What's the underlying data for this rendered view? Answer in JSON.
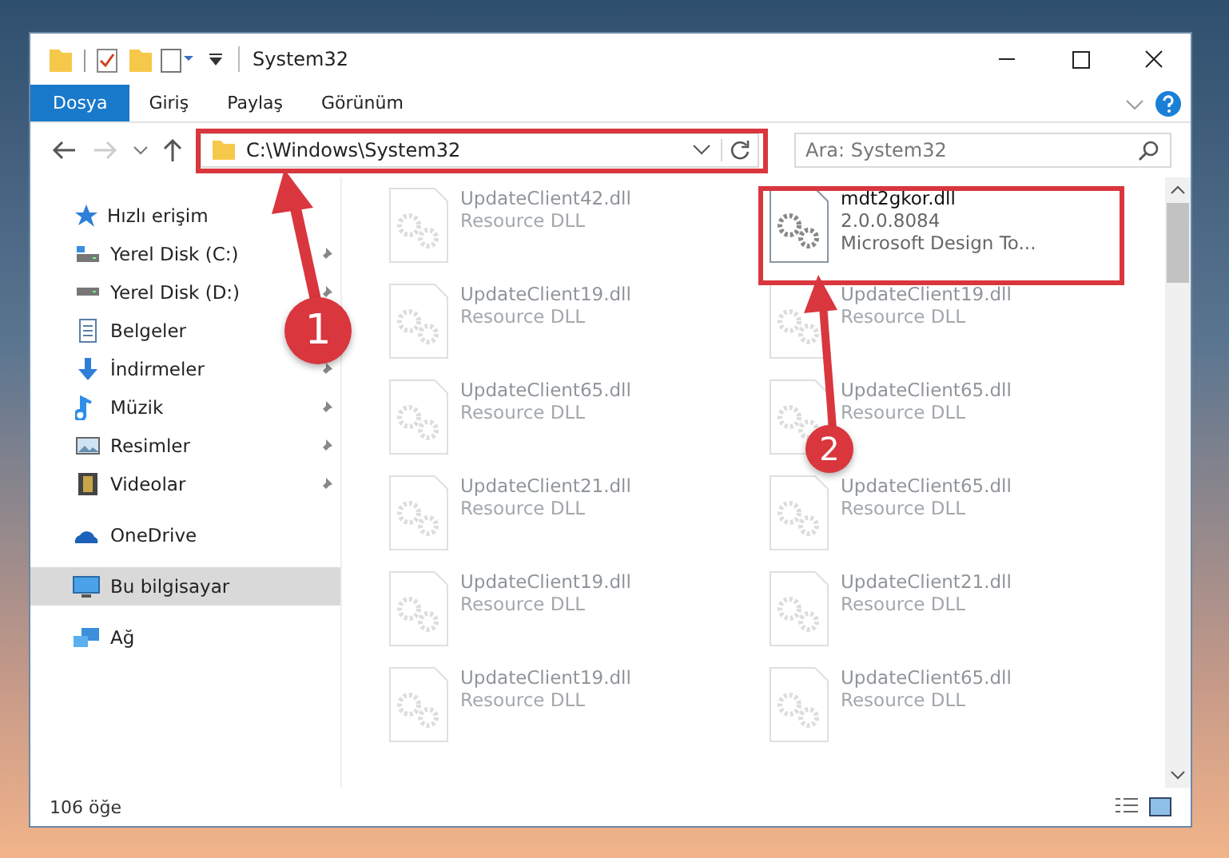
{
  "window": {
    "title": "System32"
  },
  "ribbon_tabs": [
    {
      "label": "Dosya",
      "selected": true
    },
    {
      "label": "Giriş",
      "selected": false
    },
    {
      "label": "Paylaş",
      "selected": false
    },
    {
      "label": "Görünüm",
      "selected": false
    }
  ],
  "address_bar": {
    "value": "C:\\Windows\\System32"
  },
  "search": {
    "placeholder": "Ara: System32"
  },
  "sidebar": {
    "items": [
      {
        "label": "Hızlı erişim",
        "selected": false,
        "children": [
          {
            "label": "Yerel Disk (C:)",
            "pinned": true
          },
          {
            "label": "Yerel Disk (D:)",
            "pinned": true
          },
          {
            "label": "Belgeler",
            "pinned": false
          },
          {
            "label": "İndirmeler",
            "pinned": true
          },
          {
            "label": "Müzik",
            "pinned": true
          },
          {
            "label": "Resimler",
            "pinned": true
          },
          {
            "label": "Videolar",
            "pinned": true
          }
        ]
      },
      {
        "label": "OneDrive",
        "selected": false
      },
      {
        "label": "Bu bilgisayar",
        "selected": true
      },
      {
        "label": "Ağ",
        "selected": false
      }
    ]
  },
  "files": [
    {
      "kind": "faded",
      "name": "UpdateClient42.dll",
      "lines": [
        "Resource DLL"
      ]
    },
    {
      "kind": "focus",
      "name": "mdt2gkor.dll",
      "lines": [
        "2.0.0.8084",
        "Microsoft Design To..."
      ]
    },
    {
      "kind": "faded",
      "name": "UpdateClient19.dll",
      "lines": [
        "Resource DLL"
      ]
    },
    {
      "kind": "faded",
      "name": "UpdateClient19.dll",
      "lines": [
        "Resource DLL"
      ]
    },
    {
      "kind": "faded",
      "name": "UpdateClient65.dll",
      "lines": [
        "Resource DLL"
      ]
    },
    {
      "kind": "faded",
      "name": "UpdateClient65.dll",
      "lines": [
        "Resource DLL"
      ]
    },
    {
      "kind": "faded",
      "name": "UpdateClient21.dll",
      "lines": [
        "Resource DLL"
      ]
    },
    {
      "kind": "faded",
      "name": "UpdateClient65.dll",
      "lines": [
        "Resource DLL"
      ]
    },
    {
      "kind": "faded",
      "name": "UpdateClient19.dll",
      "lines": [
        "Resource DLL"
      ]
    },
    {
      "kind": "faded",
      "name": "UpdateClient21.dll",
      "lines": [
        "Resource DLL"
      ]
    },
    {
      "kind": "faded",
      "name": "UpdateClient19.dll",
      "lines": [
        "Resource DLL"
      ]
    },
    {
      "kind": "faded",
      "name": "UpdateClient65.dll",
      "lines": [
        "Resource DLL"
      ]
    }
  ],
  "status_bar": {
    "item_count": "106 öğe"
  },
  "annotations": [
    {
      "label": "1"
    },
    {
      "label": "2"
    }
  ]
}
